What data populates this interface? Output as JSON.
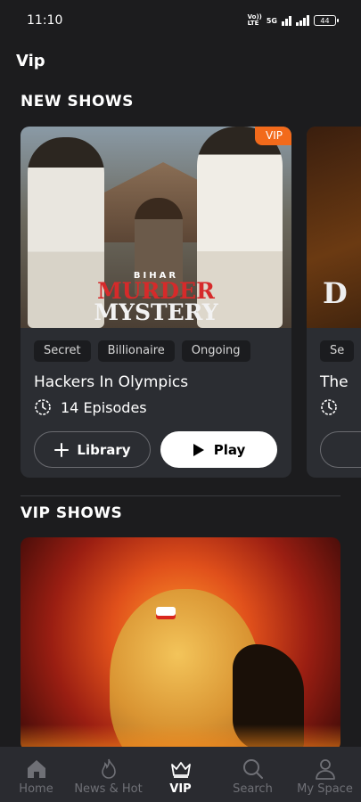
{
  "status": {
    "time": "11:10",
    "network_top": "Vo))",
    "network_bottom": "LTE",
    "network_type": "5G",
    "battery": "44"
  },
  "page": {
    "title": "Vip"
  },
  "new_shows": {
    "title": "NEW SHOWS",
    "cards": [
      {
        "badge": "VIP",
        "poster_pre": "BIHAR",
        "poster_line1": "MURDER",
        "poster_line2": "MYSTERY",
        "tags": [
          "Secret",
          "Billionaire",
          "Ongoing"
        ],
        "title": "Hackers In Olympics",
        "episodes": "14 Episodes",
        "library_label": "Library",
        "play_label": "Play"
      },
      {
        "poster_glyph": "D",
        "tags": [
          "Se"
        ],
        "title": "The",
        "episodes": ""
      }
    ]
  },
  "vip_shows": {
    "title": "VIP SHOWS"
  },
  "nav": {
    "items": [
      {
        "label": "Home",
        "icon": "home-icon"
      },
      {
        "label": "News & Hot",
        "icon": "flame-icon"
      },
      {
        "label": "VIP",
        "icon": "crown-icon"
      },
      {
        "label": "Search",
        "icon": "search-icon"
      },
      {
        "label": "My Space",
        "icon": "user-icon"
      }
    ],
    "active": "VIP"
  },
  "colors": {
    "background": "#1c1c1e",
    "card": "#2b2d32",
    "badge": "#f26a1b",
    "nav_inactive": "#6f7076"
  }
}
